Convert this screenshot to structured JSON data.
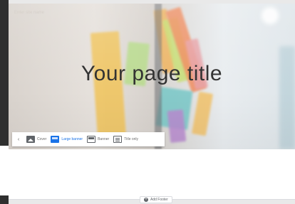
{
  "header": {
    "site_name": "Enter site name",
    "page_title": "Your page title"
  },
  "layout_toolbar": {
    "back_icon": "chevron-left-icon",
    "options": [
      {
        "label": "Cover",
        "icon": "image-icon",
        "selected": false
      },
      {
        "label": "Large banner",
        "icon": "large-banner-icon",
        "selected": true
      },
      {
        "label": "Banner",
        "icon": "banner-icon",
        "selected": false
      },
      {
        "label": "Title only",
        "icon": "title-only-icon",
        "selected": false
      }
    ],
    "selected_color": "#1a73e8"
  },
  "footer": {
    "add_footer_label": "Add Footer",
    "icon": "plus-circle-icon"
  }
}
